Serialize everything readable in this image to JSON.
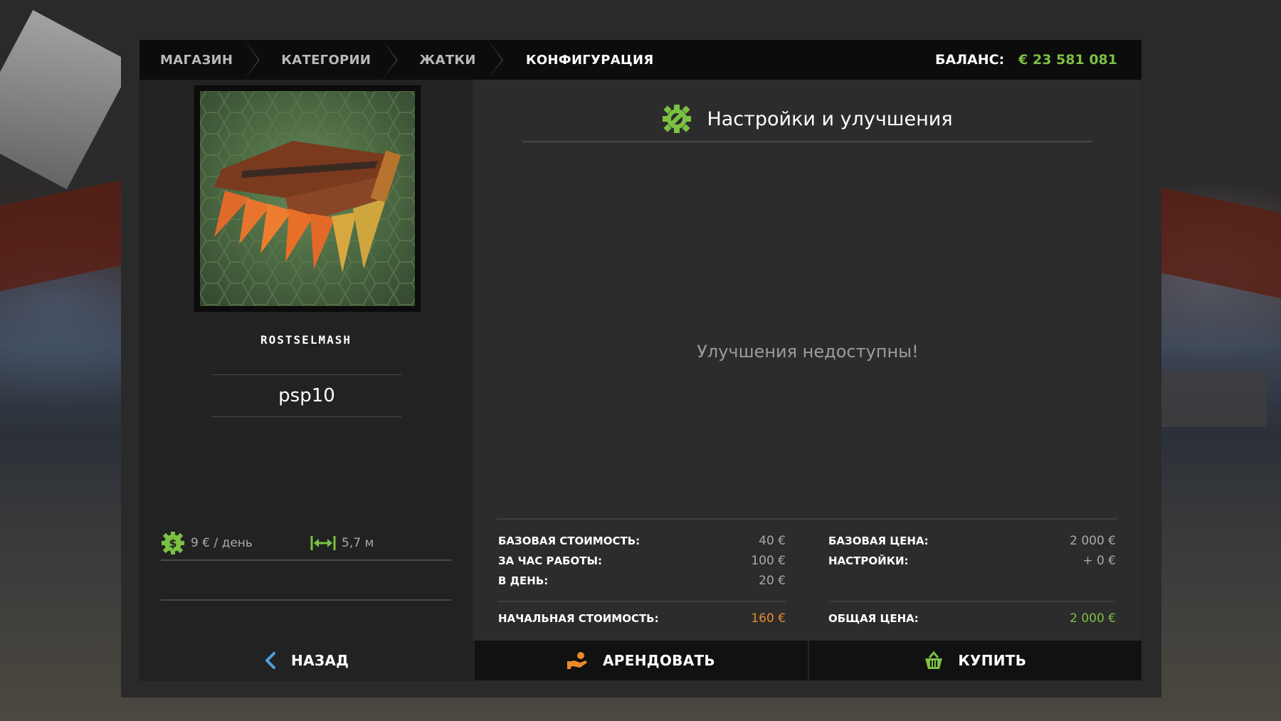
{
  "breadcrumb": {
    "items": [
      "МАГАЗИН",
      "КАТЕГОРИИ",
      "ЖАТКИ",
      "КОНФИГУРАЦИЯ"
    ]
  },
  "balance": {
    "label": "БАЛАНС:",
    "value": "€ 23 581 081"
  },
  "vehicle": {
    "brand": "ROSTSELMASH",
    "name": "psp10",
    "upkeep": "9 € / день",
    "width": "5,7 м"
  },
  "config": {
    "title": "Настройки и улучшения",
    "empty_message": "Улучшения недоступны!"
  },
  "prices": {
    "lease": [
      {
        "label": "БАЗОВАЯ СТОИМОСТЬ:",
        "value": "40 €"
      },
      {
        "label": "ЗА ЧАС РАБОТЫ:",
        "value": "100 €"
      },
      {
        "label": "В ДЕНЬ:",
        "value": "20 €"
      }
    ],
    "lease_total": {
      "label": "НАЧАЛЬНАЯ СТОИМОСТЬ:",
      "value": "160 €"
    },
    "buy": [
      {
        "label": "БАЗОВАЯ ЦЕНА:",
        "value": "2 000 €"
      },
      {
        "label": "НАСТРОЙКИ:",
        "value": "+ 0 €"
      }
    ],
    "buy_total": {
      "label": "ОБЩАЯ ЦЕНА:",
      "value": "2 000 €"
    }
  },
  "buttons": {
    "back": "НАЗАД",
    "rent": "АРЕНДОВАТЬ",
    "buy": "КУПИТЬ"
  },
  "colors": {
    "accent_green": "#7bc043",
    "accent_orange": "#e98a2a"
  },
  "icons": {
    "config": "wrench-gear-icon",
    "upkeep": "dollar-gear-icon",
    "width": "width-arrows-icon",
    "back": "chevron-left-icon",
    "rent": "hand-coin-icon",
    "buy": "basket-icon"
  }
}
